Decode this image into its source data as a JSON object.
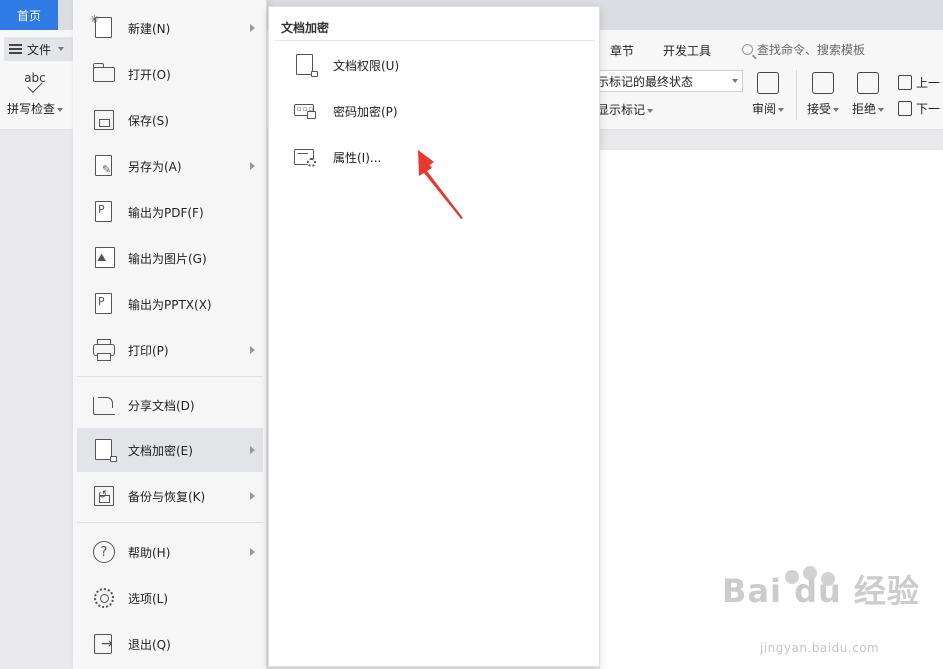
{
  "tabbar": {
    "home_tab": "首页"
  },
  "ribbon": {
    "file_label": "文件",
    "spell_abc": "abc",
    "spell_label": "拼写检查",
    "tab_section": "章节",
    "tab_dev": "开发工具",
    "search_placeholder": "查找命令、搜索模板",
    "markup_dropdown": "示标记的最终状态",
    "show_markup": "显示标记",
    "review": "审阅",
    "accept": "接受",
    "reject": "拒绝",
    "prev": "上一",
    "next": "下一"
  },
  "file_menu": {
    "items": [
      {
        "label": "新建(N)",
        "icon": "new-doc-icon",
        "has_submenu": true
      },
      {
        "label": "打开(O)",
        "icon": "folder-icon",
        "has_submenu": false
      },
      {
        "label": "保存(S)",
        "icon": "save-icon",
        "has_submenu": false
      },
      {
        "label": "另存为(A)",
        "icon": "save-as-icon",
        "has_submenu": true
      },
      {
        "label": "输出为PDF(F)",
        "icon": "pdf-icon",
        "has_submenu": false
      },
      {
        "label": "输出为图片(G)",
        "icon": "image-icon",
        "has_submenu": false
      },
      {
        "label": "输出为PPTX(X)",
        "icon": "pptx-icon",
        "has_submenu": false
      },
      {
        "label": "打印(P)",
        "icon": "printer-icon",
        "has_submenu": true
      },
      {
        "label": "分享文档(D)",
        "icon": "share-icon",
        "has_submenu": false
      },
      {
        "label": "文档加密(E)",
        "icon": "encrypt-icon",
        "has_submenu": true,
        "active": true
      },
      {
        "label": "备份与恢复(K)",
        "icon": "backup-icon",
        "has_submenu": true
      },
      {
        "label": "帮助(H)",
        "icon": "help-icon",
        "has_submenu": true
      },
      {
        "label": "选项(L)",
        "icon": "gear-icon",
        "has_submenu": false
      },
      {
        "label": "退出(Q)",
        "icon": "exit-icon",
        "has_submenu": false
      }
    ]
  },
  "submenu": {
    "title": "文档加密",
    "items": [
      {
        "label": "文档权限(U)",
        "icon": "doc-permission-icon"
      },
      {
        "label": "密码加密(P)",
        "icon": "password-lock-icon"
      },
      {
        "label": "属性(I)...",
        "icon": "properties-icon"
      }
    ]
  },
  "watermark": {
    "brand": "Bai du 经验",
    "url": "jingyan.baidu.com"
  },
  "colors": {
    "accent": "#2f7be6",
    "arrow": "#e8392c",
    "menu_bg": "#f6f6f7",
    "active_bg": "#e3e4e8"
  }
}
